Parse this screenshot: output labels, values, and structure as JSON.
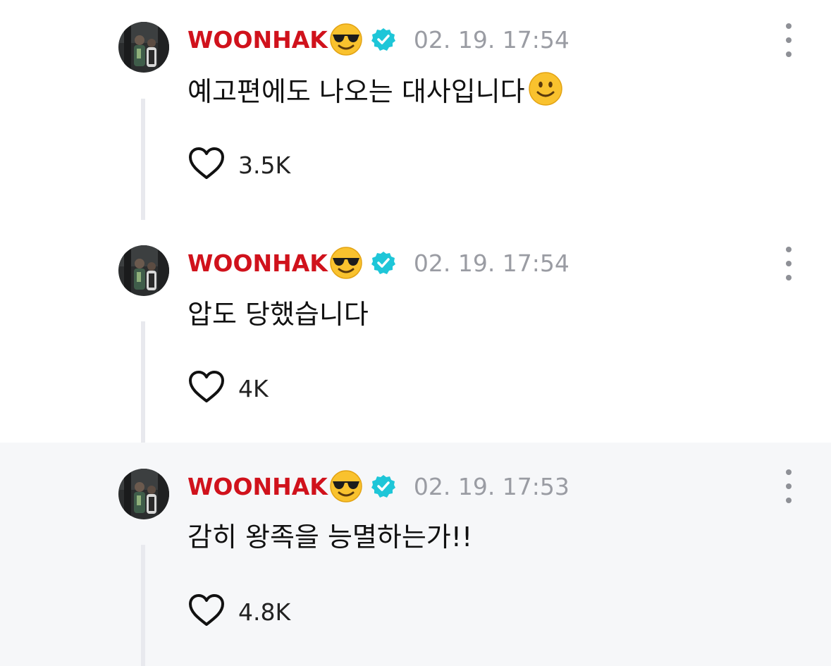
{
  "comments": [
    {
      "username": "WOONHAK",
      "name_emoji": "smiling-face-with-sunglasses",
      "verified": true,
      "timestamp": "02. 19. 17:54",
      "text": "예고편에도 나오는 대사입니다",
      "text_emoji": "slightly-smiling-face",
      "likes": "3.5K",
      "highlighted": false
    },
    {
      "username": "WOONHAK",
      "name_emoji": "smiling-face-with-sunglasses",
      "verified": true,
      "timestamp": "02. 19. 17:54",
      "text": "압도 당했습니다",
      "text_emoji": "",
      "likes": "4K",
      "highlighted": false
    },
    {
      "username": "WOONHAK",
      "name_emoji": "smiling-face-with-sunglasses",
      "verified": true,
      "timestamp": "02. 19. 17:53",
      "text": "감히 왕족을 능멸하는가!!",
      "text_emoji": "",
      "likes": "4.8K",
      "highlighted": true
    }
  ],
  "colors": {
    "username": "#d0121c",
    "verified_badge": "#1ec6d8",
    "timestamp": "#9a9ca3",
    "highlight_bg": "#f6f7f9",
    "thread_line": "#e8e9ee"
  }
}
